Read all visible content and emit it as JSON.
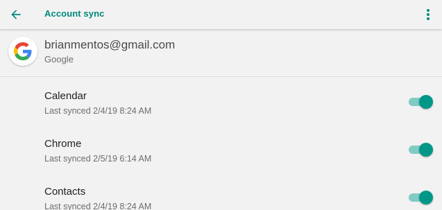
{
  "toolbar": {
    "title": "Account sync",
    "back_icon": "arrow-left-icon",
    "menu_icon": "overflow-menu-icon"
  },
  "account": {
    "email": "brianmentos@gmail.com",
    "provider": "Google",
    "logo_icon": "google-g-icon"
  },
  "sync_items": [
    {
      "title": "Calendar",
      "subtitle": "Last synced 2/4/19 8:24 AM",
      "enabled": true
    },
    {
      "title": "Chrome",
      "subtitle": "Last synced 2/5/19 6:14 AM",
      "enabled": true
    },
    {
      "title": "Contacts",
      "subtitle": "Last synced 2/4/19 8:24 AM",
      "enabled": true
    }
  ],
  "colors": {
    "accent": "#00897b",
    "toggle_thumb": "#009688",
    "toggle_track": "#80cbc4",
    "background": "#f2f2f2"
  }
}
